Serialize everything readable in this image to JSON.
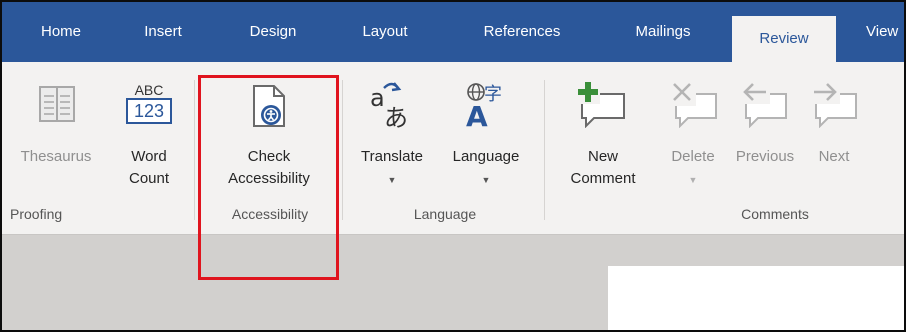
{
  "tabs": [
    {
      "label": "Home"
    },
    {
      "label": "Insert"
    },
    {
      "label": "Design"
    },
    {
      "label": "Layout"
    },
    {
      "label": "References"
    },
    {
      "label": "Mailings"
    },
    {
      "label": "Review",
      "active": true
    },
    {
      "label": "View"
    }
  ],
  "groups": {
    "proofing": {
      "label": "Proofing",
      "thesaurus": {
        "label": "Thesaurus",
        "icon": "thesaurus-book-icon",
        "enabled": false
      },
      "word_count": {
        "line1": "Word",
        "line2": "Count",
        "icon_text_top": "ABC",
        "icon_text_bottom": "123",
        "icon": "word-count-icon"
      }
    },
    "accessibility": {
      "label": "Accessibility",
      "check": {
        "line1": "Check",
        "line2": "Accessibility",
        "icon": "check-accessibility-icon"
      }
    },
    "language": {
      "label": "Language",
      "translate": {
        "label": "Translate",
        "icon": "translate-icon",
        "has_dropdown": true
      },
      "language": {
        "label": "Language",
        "icon": "language-icon",
        "has_dropdown": true
      }
    },
    "comments": {
      "label": "Comments",
      "new": {
        "line1": "New",
        "line2": "Comment",
        "icon": "new-comment-icon"
      },
      "delete": {
        "label": "Delete",
        "icon": "delete-comment-icon",
        "enabled": false,
        "has_dropdown": true
      },
      "previous": {
        "label": "Previous",
        "icon": "previous-comment-icon",
        "enabled": false
      },
      "next": {
        "label": "Next",
        "icon": "next-comment-icon",
        "enabled": false
      }
    }
  },
  "colors": {
    "title_bar": "#2b579a",
    "ribbon": "#f3f2f1",
    "highlight": "#e0141e",
    "new_comment_plus": "#3a8f3a"
  }
}
